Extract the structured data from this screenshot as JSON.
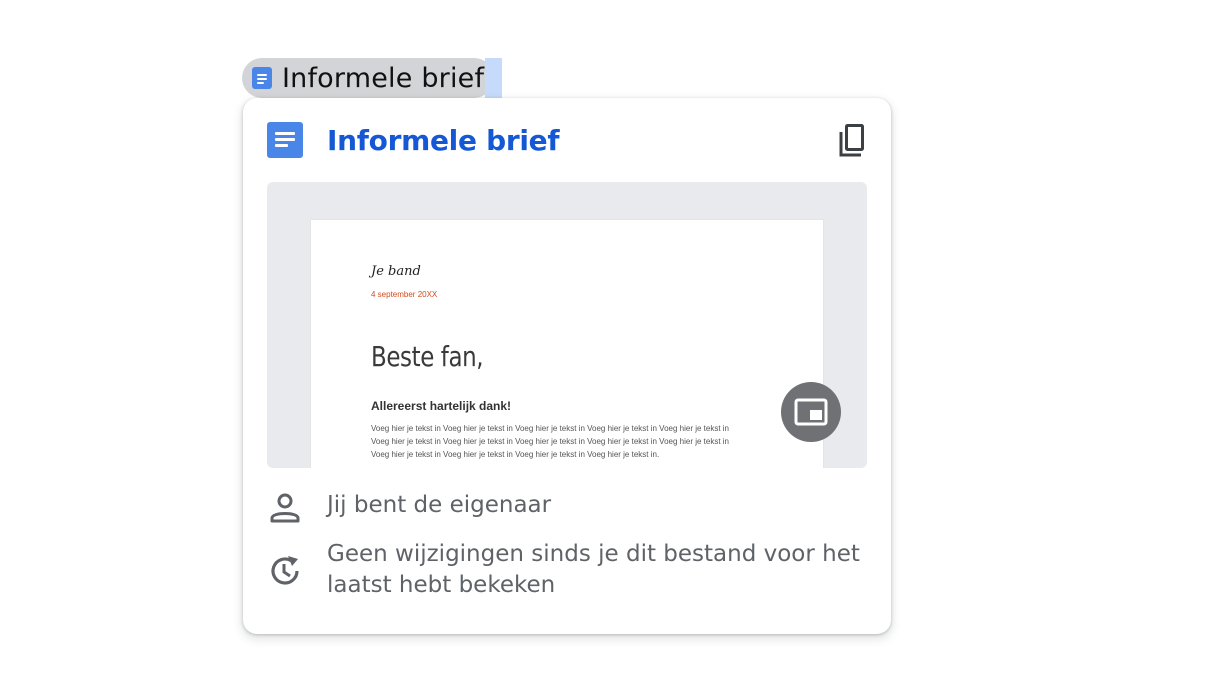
{
  "chip": {
    "label": "Informele brief",
    "icon": "docs-icon"
  },
  "card": {
    "title": "Informele brief",
    "icon": "docs-icon",
    "copy_icon": "copy-icon",
    "preview": {
      "signature": "Je band",
      "date": "4 september 20XX",
      "greeting": "Beste fan,",
      "thanks": "Allereerst hartelijk dank!",
      "body_lines": [
        "Voeg hier je tekst in Voeg hier je tekst in Voeg hier je tekst in Voeg hier je tekst in Voeg hier je tekst in",
        "Voeg hier je tekst in Voeg hier je tekst in Voeg hier je tekst in Voeg hier je tekst in Voeg hier je tekst in",
        "Voeg hier je tekst in Voeg hier je tekst in Voeg hier je tekst in Voeg hier je tekst in."
      ],
      "pip_icon": "picture-in-picture-icon"
    },
    "owner_text": "Jij bent de eigenaar",
    "owner_icon": "person-icon",
    "history_text_line1": "Geen wijzigingen sinds je dit bestand voor het",
    "history_text_line2": "laatst hebt bekeken",
    "history_icon": "history-icon"
  },
  "colors": {
    "docs_blue": "#4a86e8",
    "title_blue": "#1558d6",
    "date_orange": "#d24a1f",
    "secondary_text": "#5f6368",
    "chip_bg": "#d3d4d7",
    "preview_bg": "#e8eaed"
  }
}
